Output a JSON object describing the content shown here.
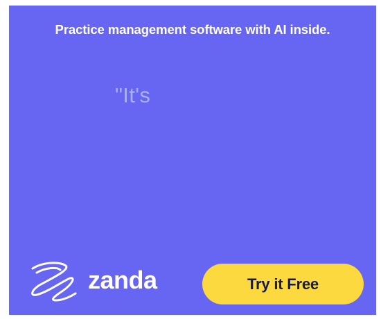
{
  "ad": {
    "headline": "Practice management software with AI inside.",
    "quote_fragment": "\"It's",
    "brand": {
      "logo_icon": "zanda-swirl-icon",
      "name": "zanda"
    },
    "cta_label": "Try it Free"
  },
  "colors": {
    "background": "#6766f2",
    "headline_text": "#ffffff",
    "quote_text": "#aab0ee",
    "cta_background": "#fcd93f",
    "cta_text": "#1a1a3a"
  }
}
